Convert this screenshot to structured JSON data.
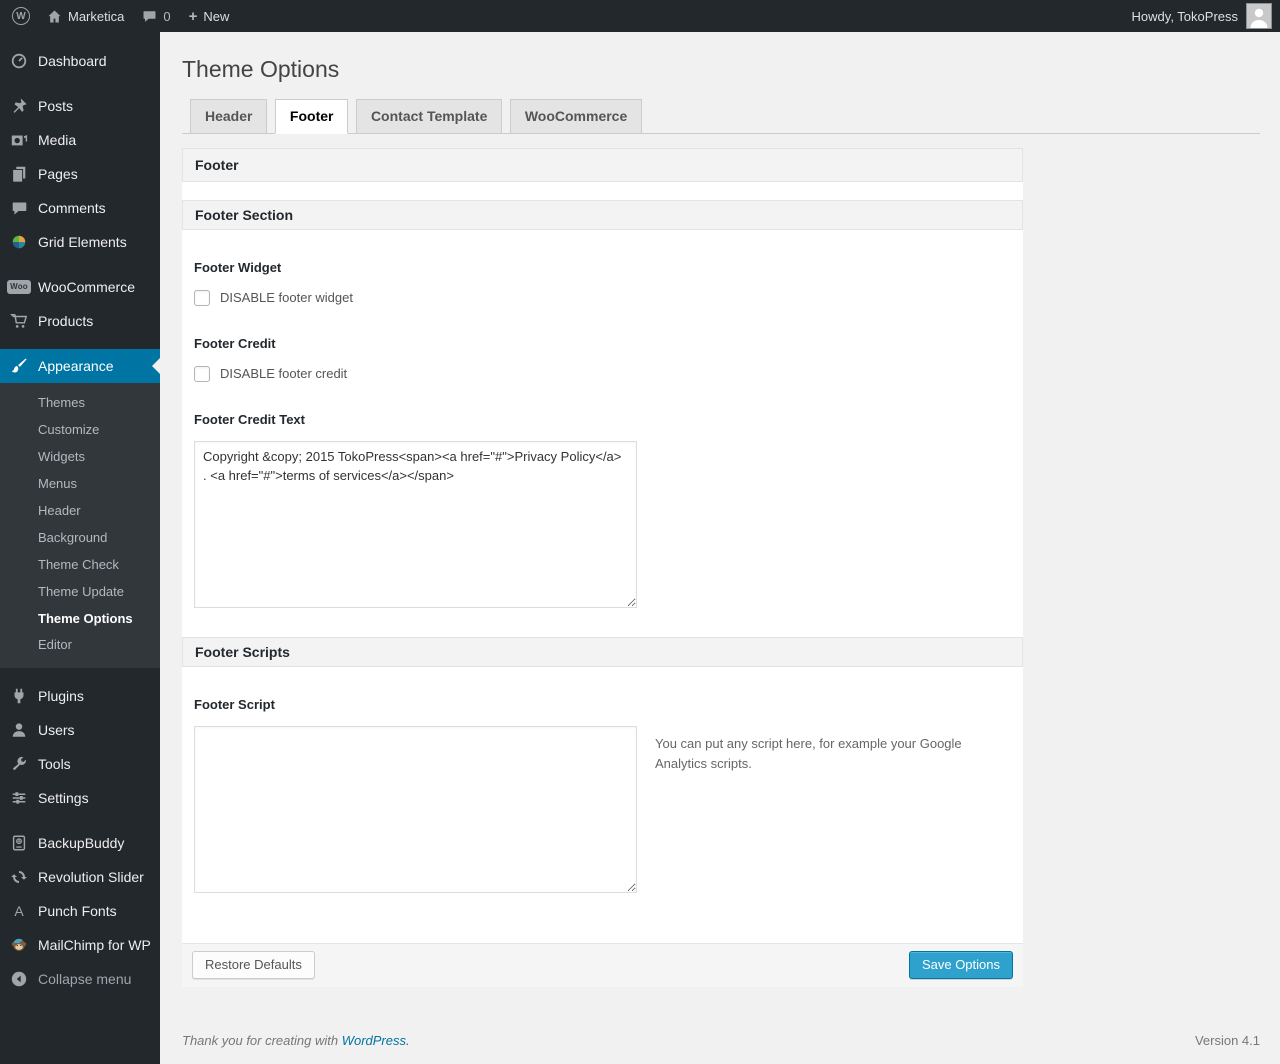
{
  "colors": {
    "accent": "#0074a2",
    "primary_button": "#2ea2cc",
    "admin_bar_bg": "#23282d",
    "page_bg": "#f1f1f1"
  },
  "icons": {
    "wp_logo_letter": "W",
    "plus_glyph": "+",
    "woo_badge": "Woo",
    "punch_fonts_glyph": "A"
  },
  "admin_bar": {
    "site_name": "Marketica",
    "comment_count": "0",
    "new_label": "New",
    "howdy": "Howdy, TokoPress"
  },
  "sidebar": {
    "menu": [
      {
        "label": "Dashboard"
      },
      {
        "label": "Posts"
      },
      {
        "label": "Media"
      },
      {
        "label": "Pages"
      },
      {
        "label": "Comments"
      },
      {
        "label": "Grid Elements"
      },
      {
        "label": "WooCommerce"
      },
      {
        "label": "Products"
      },
      {
        "label": "Appearance"
      },
      {
        "label": "Plugins"
      },
      {
        "label": "Users"
      },
      {
        "label": "Tools"
      },
      {
        "label": "Settings"
      },
      {
        "label": "BackupBuddy"
      },
      {
        "label": "Revolution Slider"
      },
      {
        "label": "Punch Fonts"
      },
      {
        "label": "MailChimp for WP"
      },
      {
        "label": "Collapse menu"
      }
    ],
    "appearance_submenu": [
      {
        "label": "Themes"
      },
      {
        "label": "Customize"
      },
      {
        "label": "Widgets"
      },
      {
        "label": "Menus"
      },
      {
        "label": "Header"
      },
      {
        "label": "Background"
      },
      {
        "label": "Theme Check"
      },
      {
        "label": "Theme Update"
      },
      {
        "label": "Theme Options"
      },
      {
        "label": "Editor"
      }
    ]
  },
  "page": {
    "title": "Theme Options",
    "tabs": [
      {
        "label": "Header"
      },
      {
        "label": "Footer"
      },
      {
        "label": "Contact Template"
      },
      {
        "label": "WooCommerce"
      }
    ]
  },
  "panel": {
    "title": "Footer",
    "footer_section_title": "Footer Section",
    "footer_scripts_title": "Footer Scripts",
    "footer_widget": {
      "label": "Footer Widget",
      "checkbox_label": "DISABLE footer widget",
      "checked": false
    },
    "footer_credit": {
      "label": "Footer Credit",
      "checkbox_label": "DISABLE footer credit",
      "checked": false
    },
    "footer_credit_text": {
      "label": "Footer Credit Text",
      "value": "Copyright &copy; 2015 TokoPress<span><a href=\"#\">Privacy Policy</a> . <a href=\"#\">terms of services</a></span>"
    },
    "footer_script": {
      "label": "Footer Script",
      "value": "",
      "help": "You can put any script here, for example your Google Analytics scripts."
    },
    "restore_button": "Restore Defaults",
    "save_button": "Save Options"
  },
  "page_footer": {
    "thanks_prefix": "Thank you for creating with ",
    "wordpress_link": "WordPress.",
    "version": "Version 4.1"
  }
}
